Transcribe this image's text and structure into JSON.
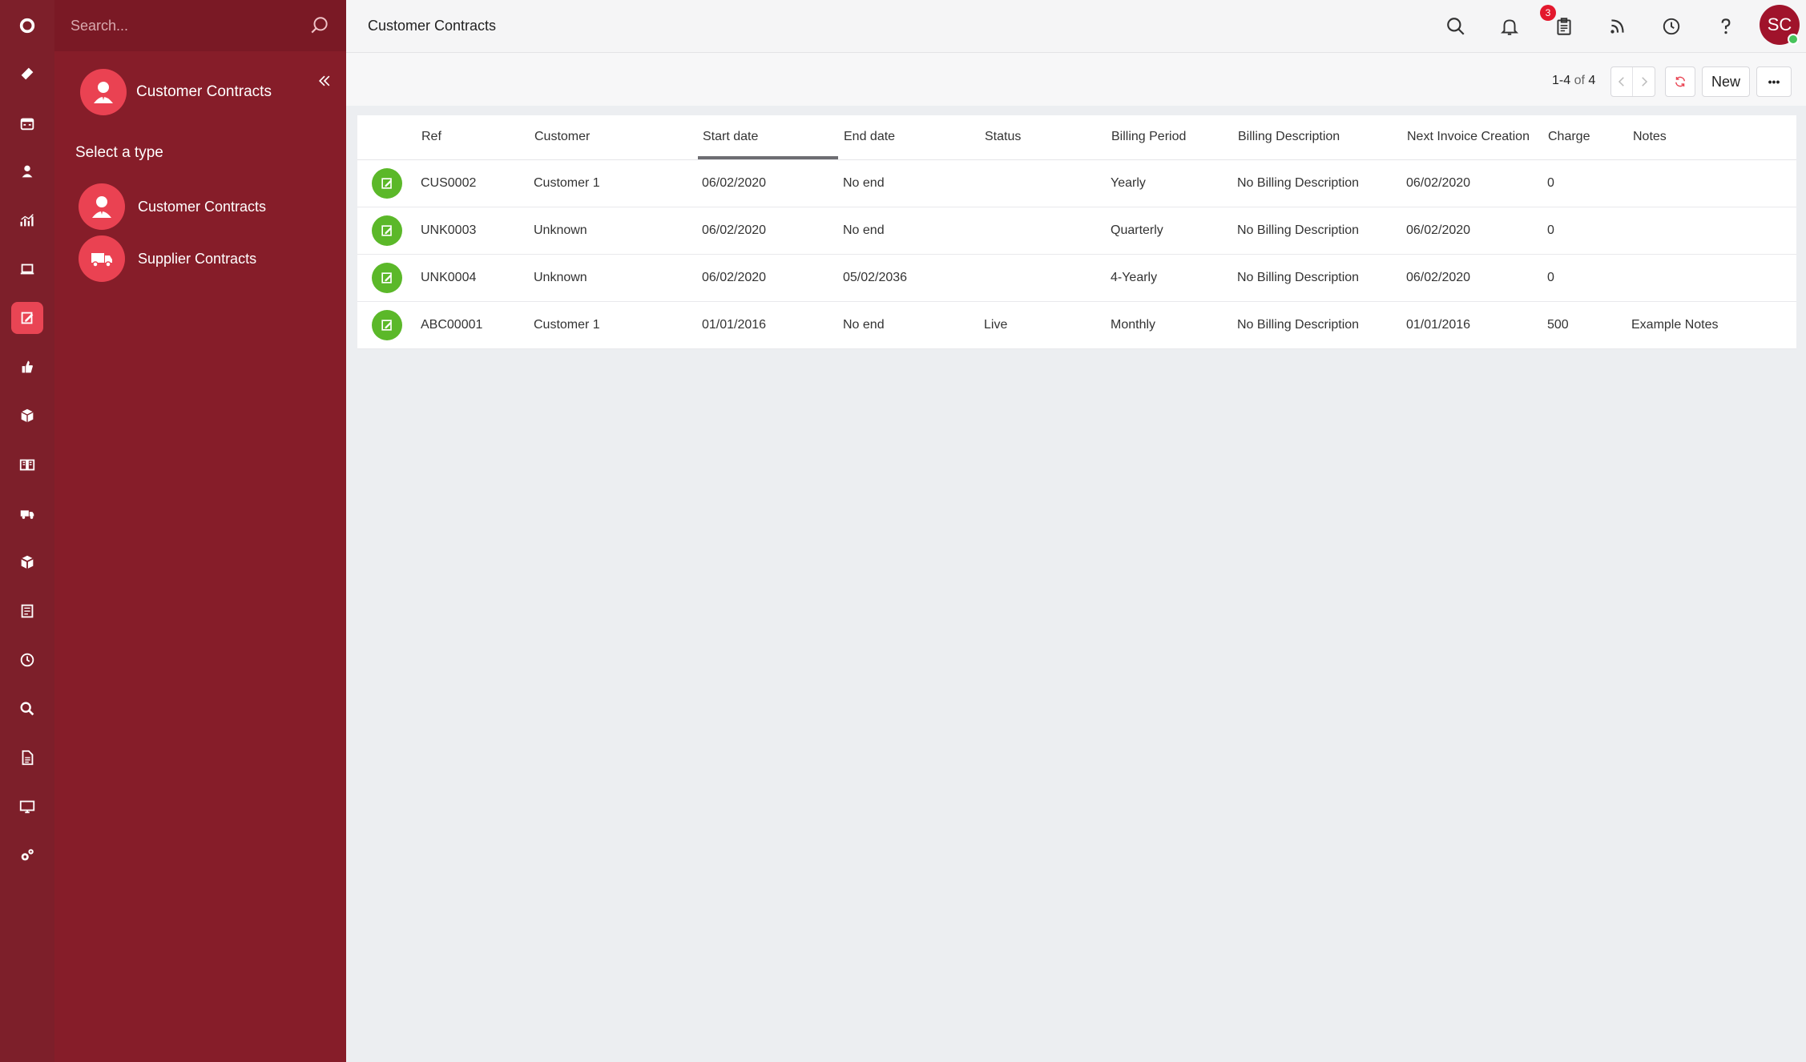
{
  "app": {
    "accent_color": "#e94554",
    "rail_color": "#7d1f2a",
    "panel_color": "#861d29"
  },
  "rail": {
    "items": [
      {
        "icon": "logo-ring-icon"
      },
      {
        "icon": "ticket-icon"
      },
      {
        "icon": "calendar-icon"
      },
      {
        "icon": "person-icon"
      },
      {
        "icon": "chart-icon"
      },
      {
        "icon": "laptop-icon"
      },
      {
        "icon": "contract-edit-icon",
        "active": true
      },
      {
        "icon": "thumbs-up-icon"
      },
      {
        "icon": "boxes-icon"
      },
      {
        "icon": "book-icon"
      },
      {
        "icon": "truck-icon"
      },
      {
        "icon": "cube-icon"
      },
      {
        "icon": "document-list-icon"
      },
      {
        "icon": "clock-icon"
      },
      {
        "icon": "search-icon"
      },
      {
        "icon": "file-icon"
      },
      {
        "icon": "monitor-icon"
      },
      {
        "icon": "gears-icon"
      }
    ]
  },
  "panel": {
    "search_placeholder": "Search...",
    "title": "Customer Contracts",
    "select_label": "Select a type",
    "types": [
      {
        "label": "Customer Contracts",
        "icon": "customer-person-icon"
      },
      {
        "label": "Supplier Contracts",
        "icon": "supplier-truck-icon"
      }
    ]
  },
  "topbar": {
    "title": "Customer Contracts",
    "badge_count": "3",
    "avatar_initials": "SC"
  },
  "toolbar": {
    "range": "1-4",
    "of_word": "of",
    "total": "4",
    "new_label": "New",
    "more_label": "•••"
  },
  "table": {
    "columns": [
      "Ref",
      "Customer",
      "Start date",
      "End date",
      "Status",
      "Billing Period",
      "Billing Description",
      "Next Invoice Creation",
      "Charge",
      "Notes"
    ],
    "rows": [
      [
        "CUS0002",
        "Customer 1",
        "06/02/2020",
        "No end",
        "",
        "Yearly",
        "No Billing Description",
        "06/02/2020",
        "0",
        ""
      ],
      [
        "UNK0003",
        "Unknown",
        "06/02/2020",
        "No end",
        "",
        "Quarterly",
        "No Billing Description",
        "06/02/2020",
        "0",
        ""
      ],
      [
        "UNK0004",
        "Unknown",
        "06/02/2020",
        "05/02/2036",
        "",
        "4-Yearly",
        "No Billing Description",
        "06/02/2020",
        "0",
        ""
      ],
      [
        "ABC00001",
        "Customer 1",
        "01/01/2016",
        "No end",
        "Live",
        "Monthly",
        "No Billing Description",
        "01/01/2016",
        "500",
        "Example Notes"
      ]
    ]
  }
}
